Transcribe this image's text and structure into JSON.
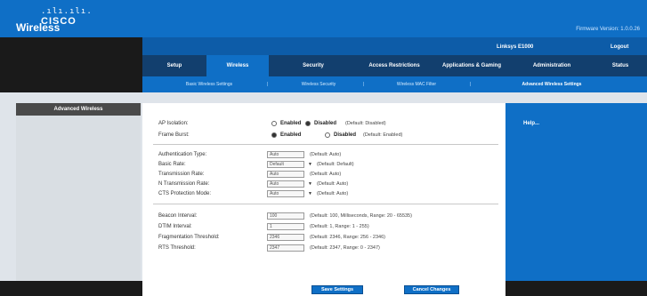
{
  "brand": {
    "dots": ".ılı.ılı.",
    "name": "CISCO"
  },
  "header": {
    "firmware": "Firmware Version: 1.0.0.26"
  },
  "section_title": "Wireless",
  "model": "Linksys E1000",
  "logout": "Logout",
  "tabs": [
    {
      "label": "Setup",
      "active": false
    },
    {
      "label": "Wireless",
      "active": true
    },
    {
      "label": "Security",
      "active": false
    },
    {
      "label": "Access Restrictions",
      "active": false
    },
    {
      "label": "Applications & Gaming",
      "active": false
    },
    {
      "label": "Administration",
      "active": false
    },
    {
      "label": "Status",
      "active": false
    }
  ],
  "subtabs": [
    {
      "label": "Basic Wireless Settings",
      "active": false
    },
    {
      "label": "Wireless Security",
      "active": false
    },
    {
      "label": "Wireless MAC Filter",
      "active": false
    },
    {
      "label": "Advanced Wireless Settings",
      "active": true
    }
  ],
  "left_panel": {
    "title": "Advanced Wireless"
  },
  "help": {
    "title": "Help..."
  },
  "form": {
    "ap_isolation": {
      "label": "AP Isolation:",
      "opt1": "Enabled",
      "opt2": "Disabled",
      "note": "(Default: Disabled)",
      "selected": "Disabled"
    },
    "frame_burst": {
      "label": "Frame Burst:",
      "opt1": "Enabled",
      "opt2": "Disabled",
      "note": "(Default: Enabled)",
      "selected": "Enabled"
    },
    "auth_type": {
      "label": "Authentication Type:",
      "value": "Auto",
      "note": "(Default: Auto)"
    },
    "basic_rate": {
      "label": "Basic Rate:",
      "value": "Default",
      "note": "(Default: Default)"
    },
    "tx_rate": {
      "label": "Transmission Rate:",
      "value": "Auto",
      "note": "(Default: Auto)"
    },
    "cts_rate": {
      "label": "N Transmission Rate:",
      "value": "Auto",
      "note": "(Default: Auto)"
    },
    "cts_mode": {
      "label": "CTS Protection Mode:",
      "value": "Auto",
      "note": "(Default: Auto)"
    },
    "beacon": {
      "label": "Beacon Interval:",
      "value": "100",
      "note": "(Default: 100, Milliseconds, Range: 20 - 65535)"
    },
    "dtim": {
      "label": "DTIM Interval:",
      "value": "1",
      "note": "(Default: 1, Range: 1 - 255)"
    },
    "frag": {
      "label": "Fragmentation Threshold:",
      "value": "2346",
      "note": "(Default: 2346, Range: 256 - 2346)"
    },
    "rts": {
      "label": "RTS Threshold:",
      "value": "2347",
      "note": "(Default: 2347, Range: 0 - 2347)"
    }
  },
  "buttons": {
    "save": "Save Settings",
    "cancel": "Cancel Changes"
  }
}
